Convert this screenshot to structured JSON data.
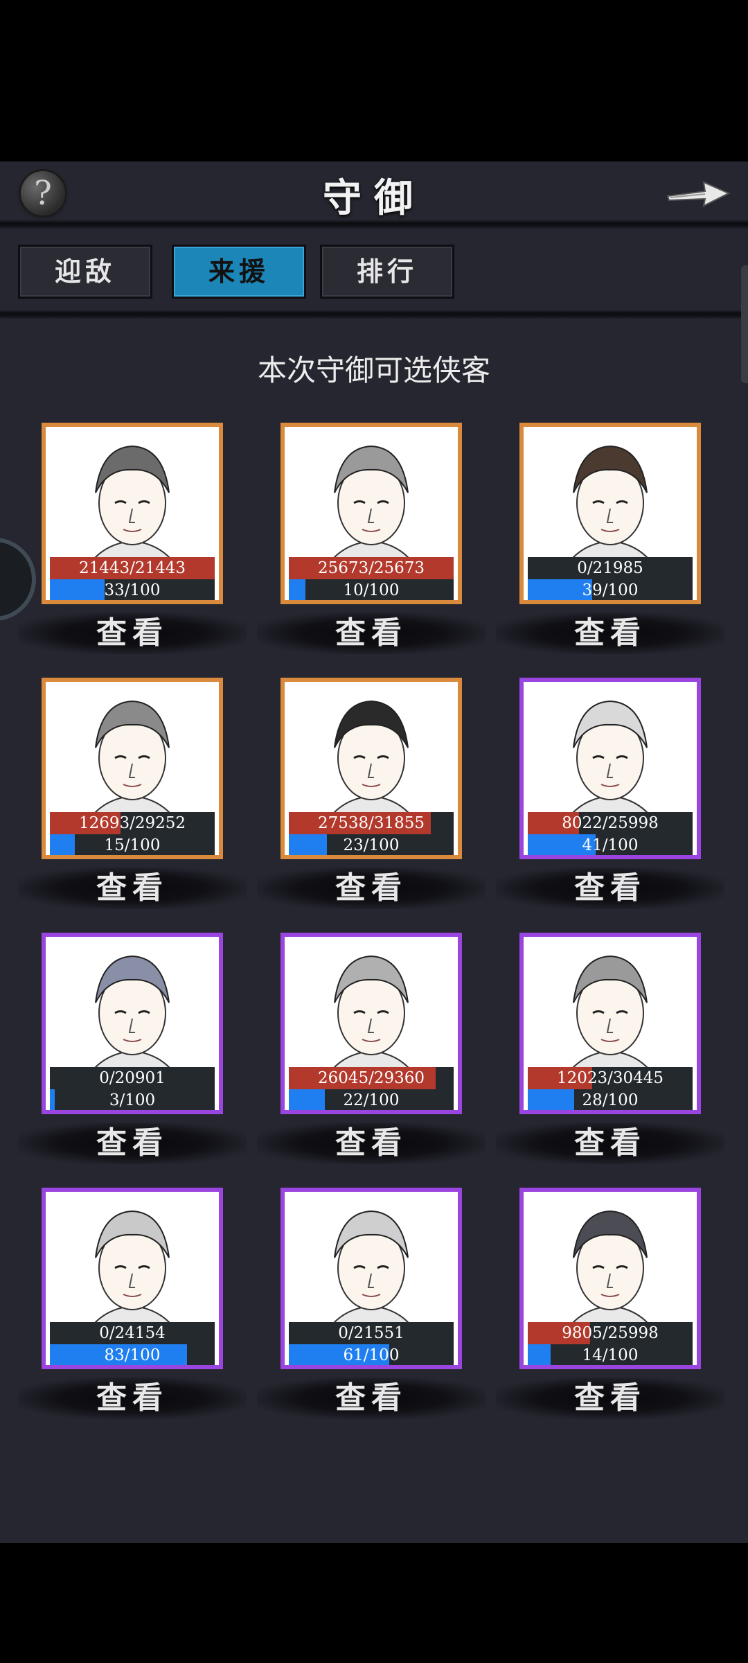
{
  "header": {
    "title": "守御",
    "help_icon": "question-mark-icon",
    "back_icon": "right-arrow-icon"
  },
  "tabs": [
    {
      "label": "迎敌",
      "active": false
    },
    {
      "label": "来援",
      "active": true
    },
    {
      "label": "排行",
      "active": false
    }
  ],
  "subtitle": "本次守御可选侠客",
  "view_label": "查看",
  "colors": {
    "orange_border": "#d98a3c",
    "purple_border": "#9b45e0",
    "hp_red": "#b3392c",
    "level_blue": "#1f7ff0",
    "tab_active": "#1d86b8"
  },
  "heroes": [
    {
      "hp": "21443/21443",
      "hp_fraction": 1.0,
      "level": "33/100",
      "level_fraction": 0.33,
      "border": "orange",
      "portrait": "man-with-headscarf-beard"
    },
    {
      "hp": "25673/25673",
      "hp_fraction": 1.0,
      "level": "10/100",
      "level_fraction": 0.1,
      "border": "orange",
      "portrait": "monk-with-cap-eyes-closed"
    },
    {
      "hp": "0/21985",
      "hp_fraction": 0.0,
      "level": "39/100",
      "level_fraction": 0.39,
      "border": "orange",
      "portrait": "flute-player"
    },
    {
      "hp": "12693/29252",
      "hp_fraction": 0.43,
      "level": "15/100",
      "level_fraction": 0.15,
      "border": "orange",
      "portrait": "bald-monk-with-beads"
    },
    {
      "hp": "27538/31855",
      "hp_fraction": 0.86,
      "level": "23/100",
      "level_fraction": 0.23,
      "border": "orange",
      "portrait": "official-with-tall-hat"
    },
    {
      "hp": "8022/25998",
      "hp_fraction": 0.31,
      "level": "41/100",
      "level_fraction": 0.41,
      "border": "purple",
      "portrait": "hooded-white-hair"
    },
    {
      "hp": "0/20901",
      "hp_fraction": 0.0,
      "level": "3/100",
      "level_fraction": 0.03,
      "border": "purple",
      "portrait": "jeweled-headdress-girl"
    },
    {
      "hp": "26045/29360",
      "hp_fraction": 0.89,
      "level": "22/100",
      "level_fraction": 0.22,
      "border": "purple",
      "portrait": "ponytail-swordsman"
    },
    {
      "hp": "12023/30445",
      "hp_fraction": 0.39,
      "level": "28/100",
      "level_fraction": 0.28,
      "border": "purple",
      "portrait": "long-hair-scholar"
    },
    {
      "hp": "0/24154",
      "hp_fraction": 0.0,
      "level": "83/100",
      "level_fraction": 0.83,
      "border": "purple",
      "portrait": "white-haired-swordsman"
    },
    {
      "hp": "0/21551",
      "hp_fraction": 0.0,
      "level": "61/100",
      "level_fraction": 0.61,
      "border": "purple",
      "portrait": "young-lady-bun"
    },
    {
      "hp": "9805/25998",
      "hp_fraction": 0.38,
      "level": "14/100",
      "level_fraction": 0.14,
      "border": "purple",
      "portrait": "noble-lady-ornate-hair"
    }
  ]
}
